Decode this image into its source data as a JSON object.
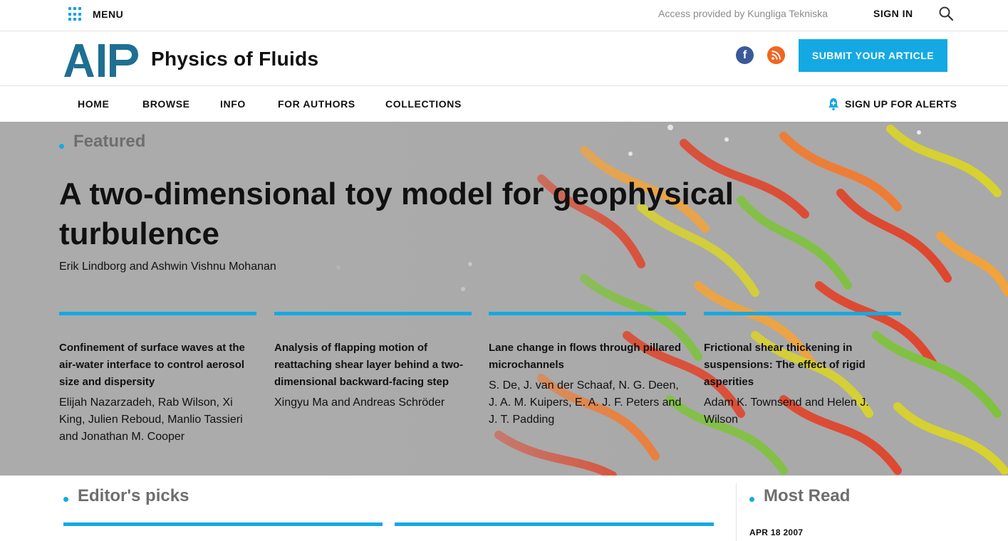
{
  "topbar": {
    "menu_label": "MENU",
    "access_text": "Access provided by Kungliga Tekniska",
    "signin_label": "SIGN IN"
  },
  "header": {
    "journal_title": "Physics of Fluids",
    "submit_label": "SUBMIT YOUR ARTICLE",
    "logo_alt": "AIP"
  },
  "nav": {
    "items": [
      "HOME",
      "BROWSE",
      "INFO",
      "FOR AUTHORS",
      "COLLECTIONS"
    ],
    "alerts_label": "SIGN UP FOR ALERTS"
  },
  "featured": {
    "label": "Featured",
    "title": "A two-dimensional toy model for geophysical turbulence",
    "authors": "Erik Lindborg and Ashwin Vishnu Mohanan",
    "cards": [
      {
        "title": "Confinement of surface waves at the air-water interface to control aerosol size and dispersity",
        "authors": "Elijah Nazarzadeh, Rab Wilson, Xi King, Julien Reboud, Manlio Tassieri and Jonathan M. Cooper"
      },
      {
        "title": "Analysis of flapping motion of reattaching shear layer behind a two-dimensional backward-facing step",
        "authors": "Xingyu Ma and Andreas Schröder"
      },
      {
        "title": "Lane change in flows through pillared microchannels",
        "authors": "S. De, J. van der Schaaf, N. G. Deen, J. A. M. Kuipers, E. A. J. F. Peters and J. T. Padding"
      },
      {
        "title": "Frictional shear thickening in suspensions: The effect of rigid asperities",
        "authors": "Adam K. Townsend and Helen J. Wilson"
      }
    ]
  },
  "editors_picks": {
    "label": "Editor's picks"
  },
  "most_read": {
    "label": "Most Read",
    "first_date": "APR 18 2007"
  },
  "colors": {
    "accent": "#14a9e3",
    "facebook": "#3b5998",
    "rss": "#f26522",
    "logo": "#1f6f93"
  },
  "icons": [
    "grid-menu-icon",
    "search-icon",
    "facebook-icon",
    "rss-icon",
    "bell-plus-icon"
  ]
}
